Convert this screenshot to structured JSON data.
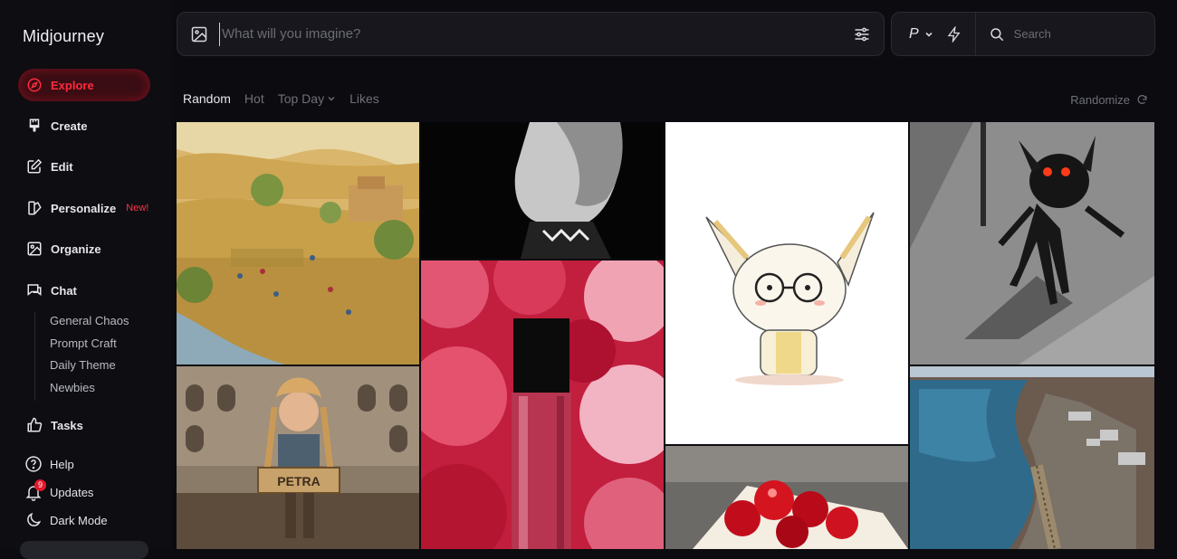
{
  "sidebar": {
    "brand": "Midjourney",
    "nav": [
      {
        "label": "Explore",
        "icon": "compass-icon",
        "active": true
      },
      {
        "label": "Create",
        "icon": "brush-icon"
      },
      {
        "label": "Edit",
        "icon": "edit-icon"
      },
      {
        "label": "Personalize",
        "icon": "personalize-icon",
        "badge": "New!"
      },
      {
        "label": "Organize",
        "icon": "image-folder-icon"
      },
      {
        "label": "Chat",
        "icon": "chat-icon"
      }
    ],
    "chat_rooms": [
      "General Chaos",
      "Prompt Craft",
      "Daily Theme",
      "Newbies"
    ],
    "tasks": {
      "label": "Tasks",
      "icon": "thumbs-up-icon"
    },
    "utilities": [
      {
        "label": "Help",
        "icon": "help-icon"
      },
      {
        "label": "Updates",
        "icon": "bell-icon",
        "count": "9"
      },
      {
        "label": "Dark Mode",
        "icon": "moon-icon"
      }
    ]
  },
  "prompt": {
    "placeholder": "What will you imagine?",
    "value": ""
  },
  "topbar": {
    "profile_label": "P",
    "search_placeholder": "Search"
  },
  "feed": {
    "tabs": [
      {
        "label": "Random",
        "active": true
      },
      {
        "label": "Hot"
      },
      {
        "label": "Top Day",
        "dropdown": true
      },
      {
        "label": "Likes"
      }
    ],
    "randomize_label": "Randomize"
  },
  "gallery": {
    "images": [
      {
        "subject": "village-farm-painting"
      },
      {
        "subject": "anime-girl-monochrome"
      },
      {
        "subject": "fennec-fox-glasses-sketch"
      },
      {
        "subject": "dark-creature-street"
      },
      {
        "subject": "perfume-bottle-roses"
      },
      {
        "subject": "colosseum-child-sign",
        "sign_text": "PETRA"
      },
      {
        "subject": "cherry-dessert"
      },
      {
        "subject": "river-bridge-aerial"
      }
    ]
  },
  "colors": {
    "background": "#0c0c10",
    "accent": "#ff2a3d",
    "panel": "#17171d"
  }
}
